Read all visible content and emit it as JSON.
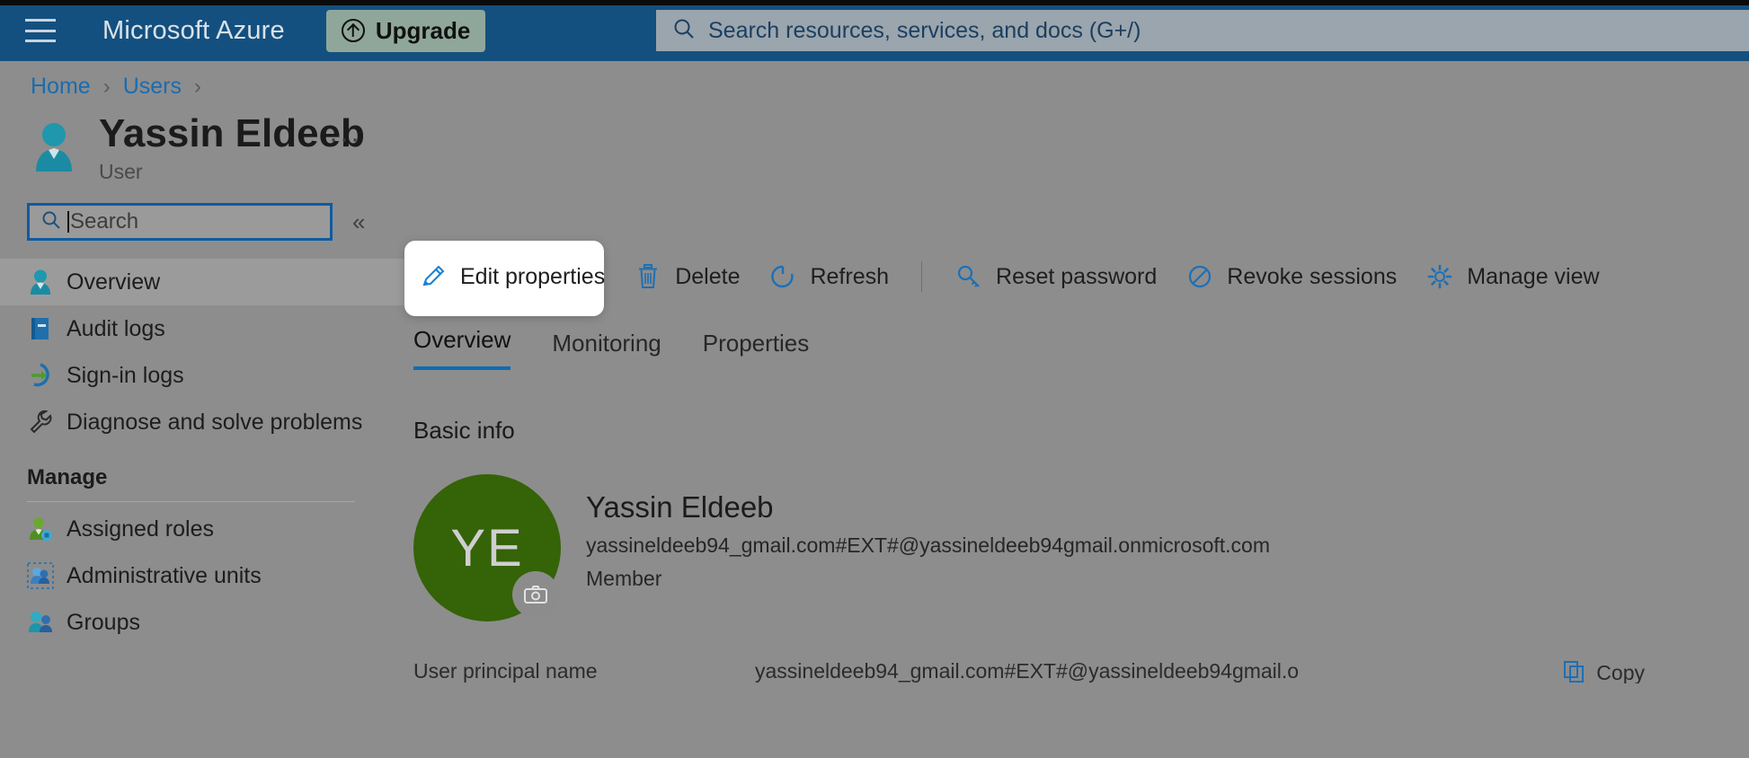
{
  "topbar": {
    "menu_icon": "hamburger-icon",
    "brand": "Microsoft Azure",
    "upgrade": {
      "label": "Upgrade",
      "icon": "upgrade-arrow-icon"
    },
    "search": {
      "icon": "search-icon",
      "placeholder": "Search resources, services, and docs (G+/)",
      "value": ""
    }
  },
  "breadcrumb": {
    "items": [
      {
        "label": "Home"
      },
      {
        "label": "Users"
      }
    ],
    "separator": "›"
  },
  "header": {
    "icon": "user-icon",
    "title": "Yassin Eldeeb",
    "subtitle": "User",
    "more_menu": "···"
  },
  "sidebar": {
    "search": {
      "icon": "search-icon",
      "placeholder": "Search",
      "value": ""
    },
    "collapse": "«",
    "items": [
      {
        "label": "Overview",
        "icon": "user-icon",
        "selected": true
      },
      {
        "label": "Audit logs",
        "icon": "book-icon",
        "selected": false
      },
      {
        "label": "Sign-in logs",
        "icon": "sign-in-icon",
        "selected": false
      },
      {
        "label": "Diagnose and solve problems",
        "icon": "wrench-icon",
        "selected": false
      }
    ],
    "group": {
      "title": "Manage",
      "items": [
        {
          "label": "Assigned roles",
          "icon": "assigned-roles-icon"
        },
        {
          "label": "Administrative units",
          "icon": "administrative-units-icon"
        },
        {
          "label": "Groups",
          "icon": "groups-icon"
        }
      ]
    }
  },
  "toolbar": {
    "items": [
      {
        "label": "Edit properties",
        "icon": "pencil-icon",
        "highlighted": true
      },
      {
        "label": "Delete",
        "icon": "trash-icon",
        "highlighted": false
      },
      {
        "label": "Refresh",
        "icon": "refresh-icon",
        "highlighted": false
      },
      {
        "label": "Reset password",
        "icon": "key-icon",
        "highlighted": false
      },
      {
        "label": "Revoke sessions",
        "icon": "block-icon",
        "highlighted": false
      },
      {
        "label": "Manage view",
        "icon": "gear-icon",
        "highlighted": false
      }
    ]
  },
  "tabs": [
    {
      "label": "Overview",
      "active": true
    },
    {
      "label": "Monitoring",
      "active": false
    },
    {
      "label": "Properties",
      "active": false
    }
  ],
  "main": {
    "section_title": "Basic info",
    "avatar": {
      "initials": "YE",
      "color": "#356308",
      "camera_icon": "camera-icon"
    },
    "name": "Yassin Eldeeb",
    "email": "yassineldeeb94_gmail.com#EXT#@yassineldeeb94gmail.onmicrosoft.com",
    "user_type": "Member",
    "bottom_row": {
      "label": "User principal name",
      "value": "yassineldeeb94_gmail.com#EXT#@yassineldeeb94gmail.o",
      "copy_label": "Copy",
      "copy_icon": "copy-icon"
    }
  },
  "colors": {
    "azure_blue": "#14507f",
    "link_blue": "#1a6cb0",
    "accent_blue": "#0e6cb4",
    "avatar_green": "#356308",
    "upgrade_bg": "#8fa79a"
  }
}
